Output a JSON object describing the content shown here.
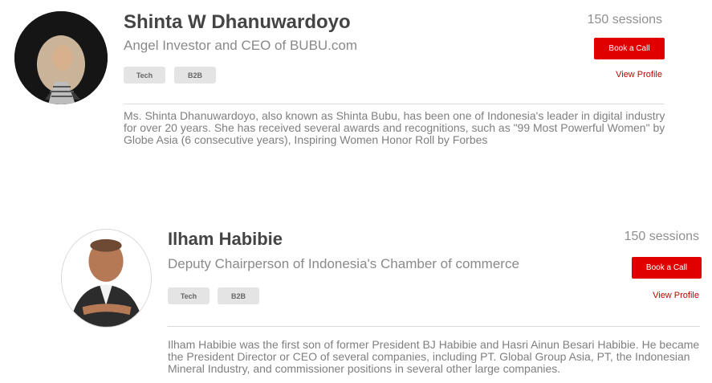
{
  "mentors": [
    {
      "name": "Shinta W Dhanuwardoyo",
      "title": "Angel Investor and CEO of BUBU.com",
      "tags": [
        "Tech",
        "B2B"
      ],
      "sessions": "150 sessions",
      "book_label": "Book a Call",
      "profile_label": "View Profile",
      "bio": "Ms. Shinta Dhanuwardoyo, also known as Shinta Bubu, has been one of Indonesia's leader in digital industry for over 20 years. She has received several awards and recognitions, such as \"99 Most Powerful Women\" by Globe Asia (6 consecutive years), Inspiring Women Honor Roll by Forbes"
    },
    {
      "name": "Ilham Habibie",
      "title": "Deputy Chairperson of Indonesia's Chamber of commerce",
      "tags": [
        "Tech",
        "B2B"
      ],
      "sessions": "150 sessions",
      "book_label": "Book a Call",
      "profile_label": "View Profile",
      "bio": "Ilham Habibie was the first son of former President BJ Habibie and Hasri Ainun Besari Habibie. He became the President Director or CEO of several companies, including PT. Global Group Asia, PT, the Indonesian Mineral Industry, and commissioner positions in several other large companies."
    }
  ],
  "colors": {
    "accent": "#e10000",
    "link": "#c40000"
  }
}
